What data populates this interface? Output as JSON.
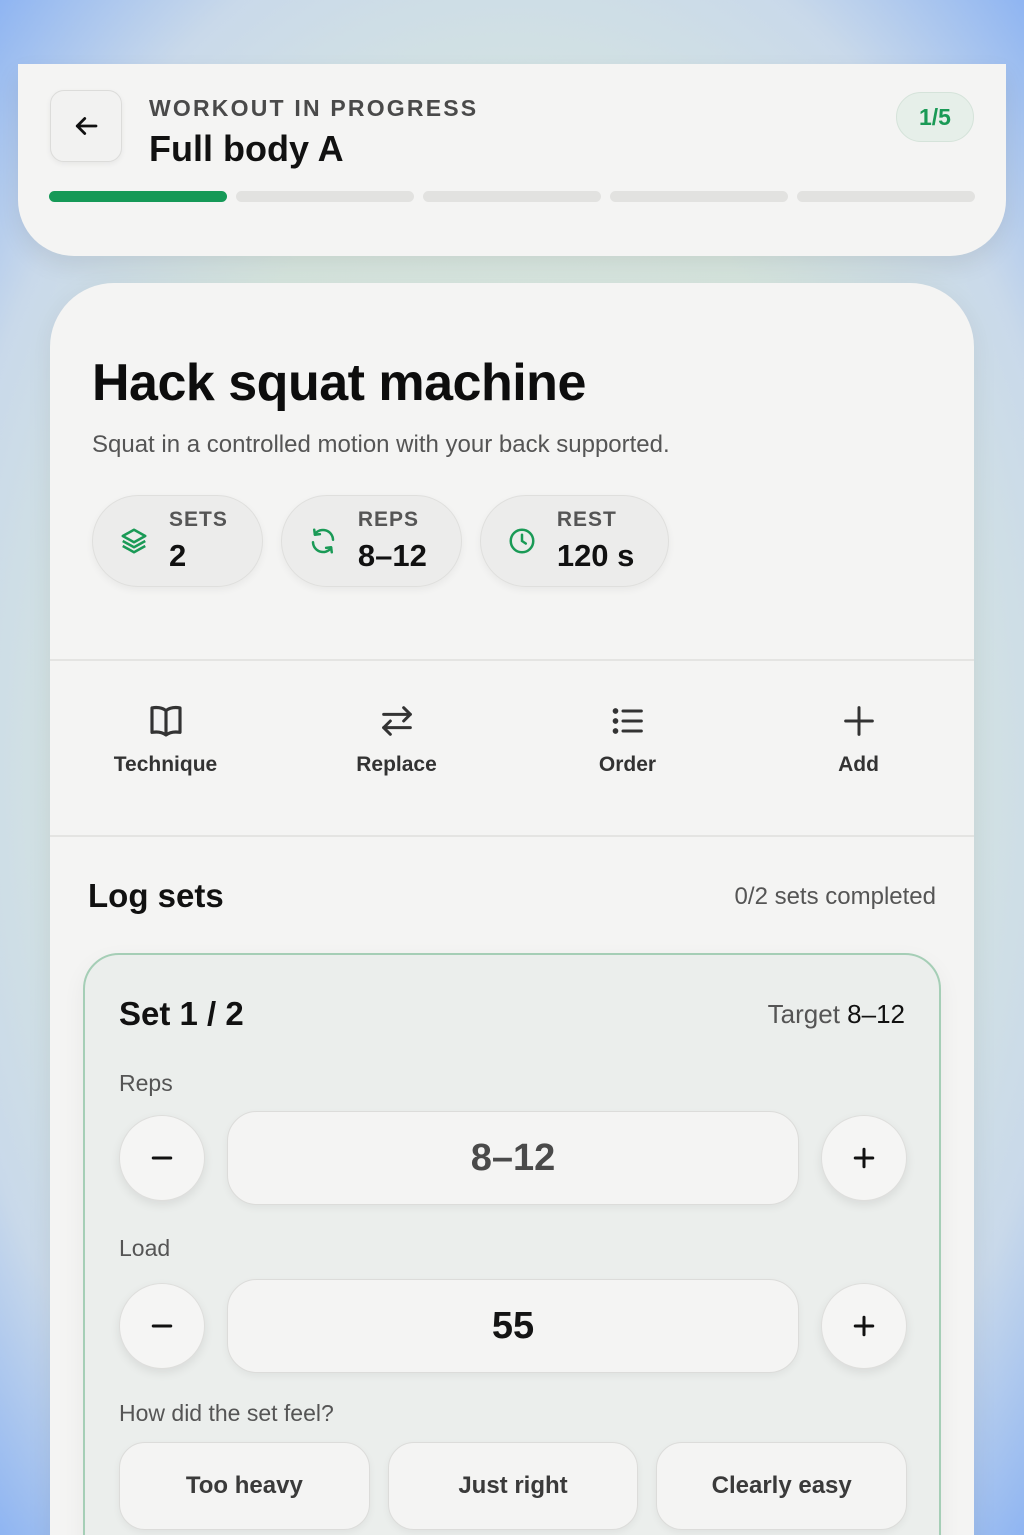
{
  "header": {
    "eyebrow": "WORKOUT IN PROGRESS",
    "title": "Full body A",
    "counter": "1/5",
    "progress": {
      "completed": 1,
      "total": 5
    }
  },
  "exercise": {
    "title": "Hack squat machine",
    "description": "Squat in a controlled motion with your back supported.",
    "stats": [
      {
        "label": "SETS",
        "value": "2",
        "icon": "layers-icon"
      },
      {
        "label": "REPS",
        "value": "8–12",
        "icon": "refresh-icon"
      },
      {
        "label": "REST",
        "value": "120 s",
        "icon": "clock-icon"
      }
    ]
  },
  "actions": [
    {
      "label": "Technique",
      "icon": "book-icon"
    },
    {
      "label": "Replace",
      "icon": "swap-icon"
    },
    {
      "label": "Order",
      "icon": "list-icon"
    },
    {
      "label": "Add",
      "icon": "plus-icon"
    }
  ],
  "log": {
    "title": "Log sets",
    "completed_text": "0/2 sets completed",
    "set": {
      "title": "Set 1 / 2",
      "target_label": "Target",
      "target_value": "8–12",
      "reps_label": "Reps",
      "reps_value": "8–12",
      "load_label": "Load",
      "load_value": "55",
      "feel_label": "How did the set feel?",
      "feel_options": [
        "Too heavy",
        "Just right",
        "Clearly easy"
      ]
    }
  },
  "colors": {
    "accent": "#159957",
    "accent_text": "#1a9a56",
    "set_border": "#a5ceb6"
  }
}
